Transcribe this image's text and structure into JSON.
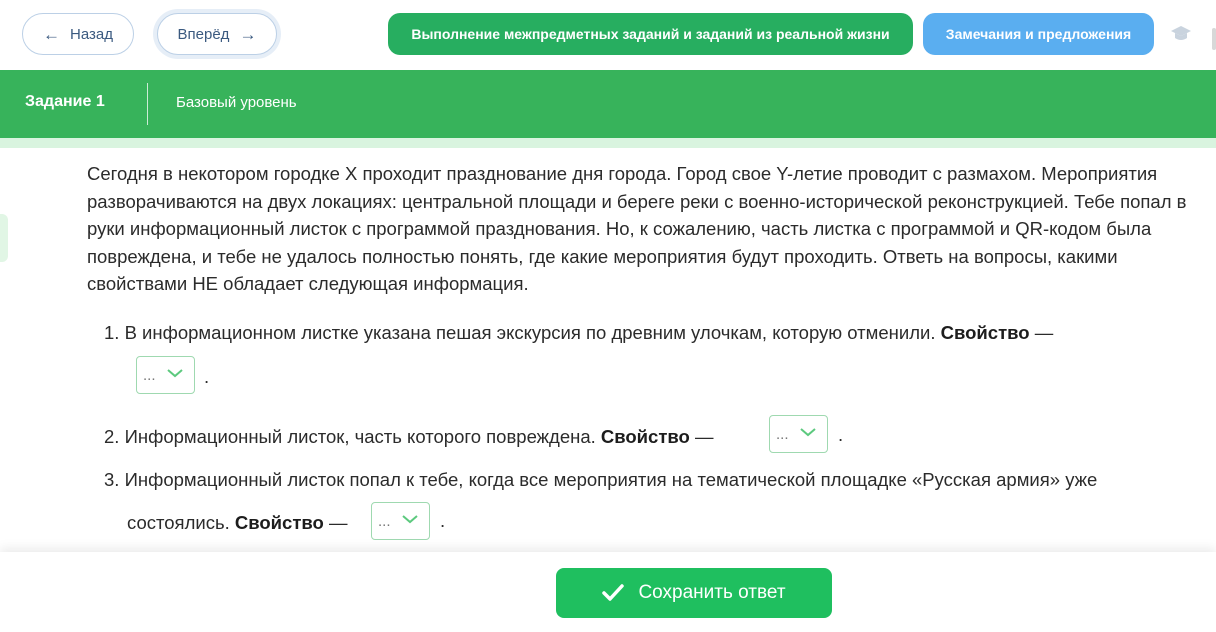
{
  "nav": {
    "back_label": "Назад",
    "forward_label": "Вперёд"
  },
  "header": {
    "section_button": "Выполнение межпредметных заданий и заданий из реальной жизни",
    "feedback_button": "Замечания и предложения",
    "icons": {
      "back": "arrow-left-icon",
      "forward": "arrow-right-icon",
      "profile": "graduation-cap-icon"
    }
  },
  "task": {
    "title": "Задание 1",
    "level": "Базовый уровень"
  },
  "intro": "Сегодня в некотором городке X проходит празднование дня города. Город свое Y-летие проводит с размахом. Мероприятия разворачиваются на двух локациях: центральной площади и береге реки с военно-исторической реконструкцией. Тебе попал в руки информационный листок с программой празднования. Но, к сожалению, часть листка с программой и QR-кодом была повреждена, и тебе не удалось полностью понять, где какие мероприятия будут проходить. Ответь на вопросы, какими свойствами НЕ обладает следующая информация.",
  "questions": [
    {
      "number": "1.",
      "text": "В информационном листке указана пешая экскурсия по древним улочкам, которую отменили.",
      "property_label": "Свойство",
      "dash": "—",
      "selected": "...",
      "end": "."
    },
    {
      "number": "2.",
      "text": "Информационный листок, часть которого повреждена.",
      "property_label": "Свойство",
      "dash": "—",
      "selected": "...",
      "end": "."
    },
    {
      "number": "3.",
      "text": "Информационный листок попал к тебе, когда все мероприятия на тематической площадке «Русская армия» уже",
      "text_cont": "состоялись.",
      "property_label": "Свойство",
      "dash": "—",
      "selected": "...",
      "end": "."
    }
  ],
  "footer": {
    "save_label": "Сохранить ответ",
    "save_icon": "checkmark-icon"
  },
  "colors": {
    "band": "#37b35b",
    "section_button": "#27ae60",
    "feedback_button": "#5aaef0",
    "save_button": "#1fbf5f"
  }
}
